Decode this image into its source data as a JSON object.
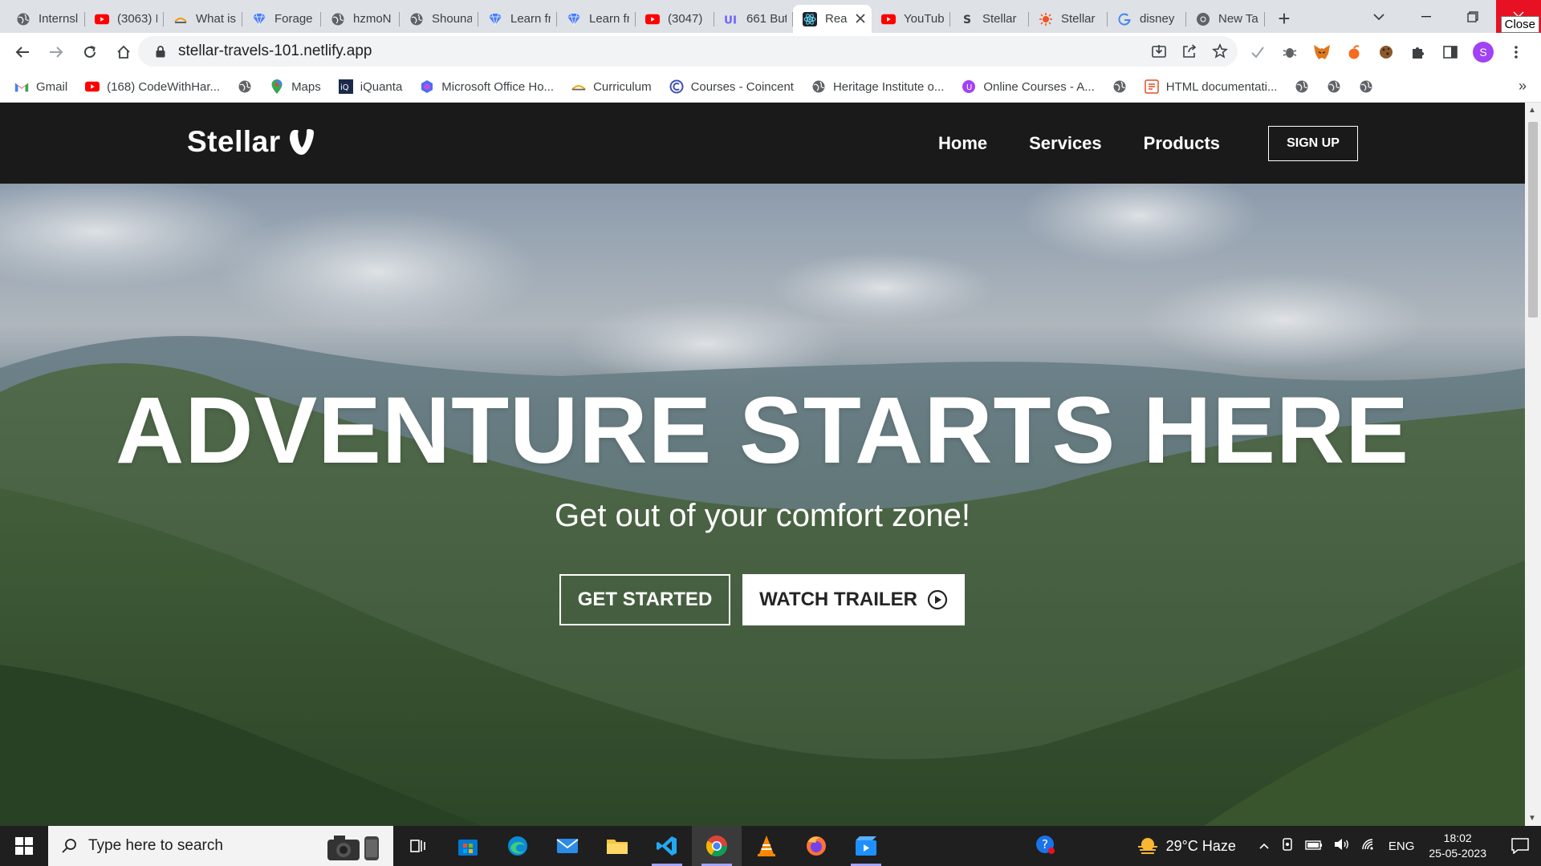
{
  "browser": {
    "tabs": [
      {
        "title": "Internsl",
        "icon": "globe-icon"
      },
      {
        "title": "(3063) I",
        "icon": "youtube-icon"
      },
      {
        "title": "What is",
        "icon": "site-icon"
      },
      {
        "title": "Forage",
        "icon": "diamond-icon"
      },
      {
        "title": "hzmoN",
        "icon": "globe-icon"
      },
      {
        "title": "Shouna",
        "icon": "globe-icon"
      },
      {
        "title": "Learn fr",
        "icon": "diamond-icon"
      },
      {
        "title": "Learn fr",
        "icon": "diamond-icon"
      },
      {
        "title": "(3047) ",
        "icon": "youtube-icon"
      },
      {
        "title": "661 But",
        "icon": "ui-icon"
      },
      {
        "title": "Rea",
        "icon": "react-icon",
        "active": true
      },
      {
        "title": "YouTub",
        "icon": "youtube-icon"
      },
      {
        "title": "Stellar",
        "icon": "stellar-s-icon"
      },
      {
        "title": "Stellar",
        "icon": "sun-icon"
      },
      {
        "title": "disney",
        "icon": "google-icon"
      },
      {
        "title": "New Ta",
        "icon": "chrome-icon"
      }
    ],
    "new_tab": "+",
    "close_tooltip": "Close",
    "url": "stellar-travels-101.netlify.app",
    "profile_initial": "S",
    "bookmarks": [
      {
        "label": "Gmail",
        "icon": "gmail-icon"
      },
      {
        "label": "(168) CodeWithHar...",
        "icon": "youtube-icon"
      },
      {
        "label": "",
        "icon": "globe-icon"
      },
      {
        "label": "Maps",
        "icon": "maps-icon"
      },
      {
        "label": "iQuanta",
        "icon": "iquanta-icon"
      },
      {
        "label": "Microsoft Office Ho...",
        "icon": "office-icon"
      },
      {
        "label": "Curriculum",
        "icon": "curriculum-icon"
      },
      {
        "label": "Courses - Coincent",
        "icon": "coincent-icon"
      },
      {
        "label": "Heritage Institute o...",
        "icon": "globe-icon"
      },
      {
        "label": "Online Courses - A...",
        "icon": "online-courses-icon"
      },
      {
        "label": "",
        "icon": "globe-icon"
      },
      {
        "label": "HTML documentati...",
        "icon": "html-doc-icon"
      },
      {
        "label": "",
        "icon": "globe-icon"
      },
      {
        "label": "",
        "icon": "globe-icon"
      },
      {
        "label": "",
        "icon": "globe-icon"
      }
    ],
    "bookmarks_more": "»"
  },
  "site": {
    "brand": "Stellar",
    "nav": [
      "Home",
      "Services",
      "Products"
    ],
    "signup": "SIGN UP",
    "hero_title": "ADVENTURE STARTS HERE",
    "hero_subtitle": "Get out of your comfort zone!",
    "primary_button": "GET STARTED",
    "secondary_button": "WATCH TRAILER"
  },
  "taskbar": {
    "search_placeholder": "Type here to search",
    "weather": "29°C  Haze",
    "language": "ENG",
    "time": "18:02",
    "date": "25-05-2023"
  },
  "colors": {
    "nav_bg": "#1a1a1a",
    "accent_close": "#e81123",
    "button_text": "#242424"
  }
}
